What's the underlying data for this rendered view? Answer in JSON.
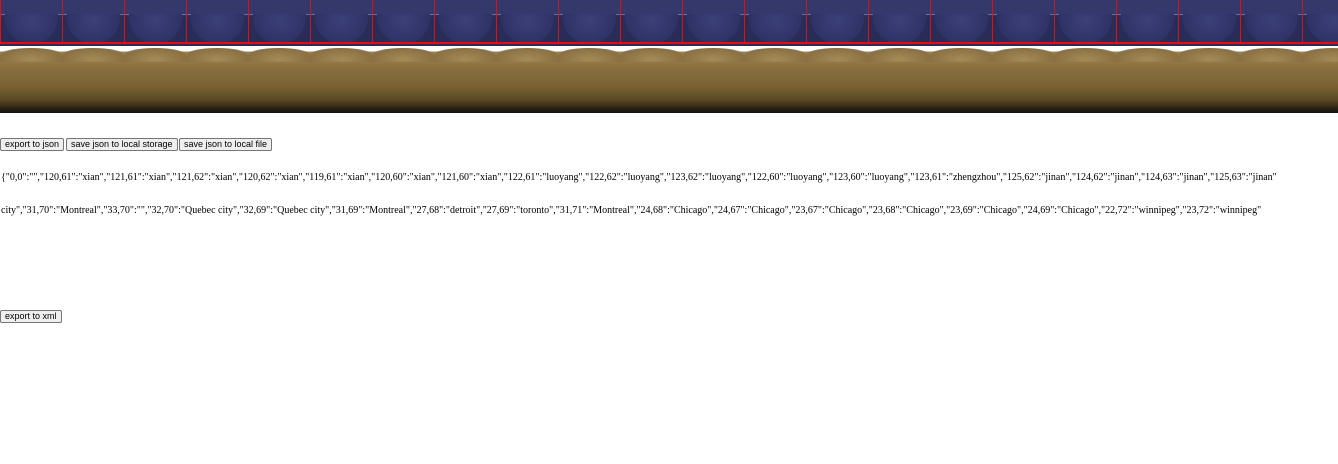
{
  "map_tiles": {
    "count": 22,
    "border_color": "#e01010",
    "tile_color": "#2f3266",
    "ground_color": "#8a7040"
  },
  "toolbar": {
    "export_json_label": "export to json",
    "save_local_storage_label": "save json to local storage",
    "save_local_file_label": "save json to local file"
  },
  "json_output": {
    "line1": "{\"0,0\":\"\",\"120,61\":\"xian\",\"121,61\":\"xian\",\"121,62\":\"xian\",\"120,62\":\"xian\",\"119,61\":\"xian\",\"120,60\":\"xian\",\"121,60\":\"xian\",\"122,61\":\"luoyang\",\"122,62\":\"luoyang\",\"123,62\":\"luoyang\",\"122,60\":\"luoyang\",\"123,60\":\"luoyang\",\"123,61\":\"zhengzhou\",\"125,62\":\"jinan\",\"124,62\":\"jinan\",\"124,63\":\"jinan\",\"125,63\":\"jinan\"",
    "line2": "city\",\"31,70\":\"Montreal\",\"33,70\":\"\",\"32,70\":\"Quebec city\",\"32,69\":\"Quebec city\",\"31,69\":\"Montreal\",\"27,68\":\"detroit\",\"27,69\":\"toronto\",\"31,71\":\"Montreal\",\"24,68\":\"Chicago\",\"24,67\":\"Chicago\",\"23,67\":\"Chicago\",\"23,68\":\"Chicago\",\"23,69\":\"Chicago\",\"24,69\":\"Chicago\",\"22,72\":\"winnipeg\",\"23,72\":\"winnipeg\""
  },
  "xml": {
    "export_xml_label": "export to xml"
  }
}
